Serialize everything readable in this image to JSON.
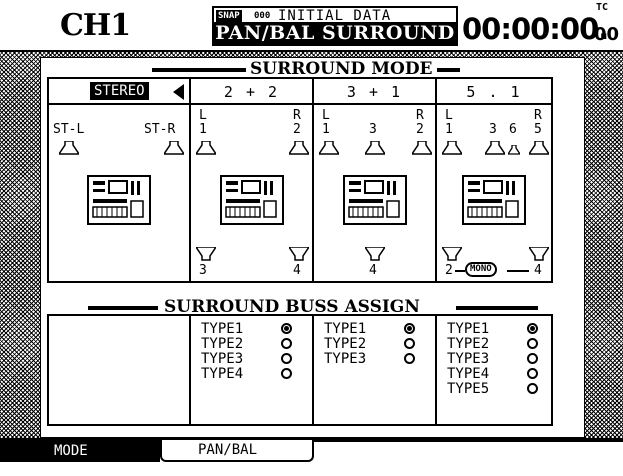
{
  "header": {
    "channel": "CH1",
    "snap_badge": "SNAP",
    "snap_number": "000",
    "snap_name": "INITIAL_DATA",
    "screen_title": "PAN/BAL SURROUND",
    "tc_label": "TC",
    "timecode": "00:00:00.",
    "timecode_frames": "00"
  },
  "surround_mode": {
    "title": "SURROUND MODE",
    "columns": [
      {
        "label": "STEREO",
        "selected": true,
        "top_channels": [
          "ST-L",
          "ST-R"
        ],
        "bottom_channels": []
      },
      {
        "label": "2 + 2",
        "top_channels": [
          "L 1",
          "R 2"
        ],
        "bottom_channels": [
          "3",
          "4"
        ]
      },
      {
        "label": "3 + 1",
        "top_channels": [
          "L 1",
          "3",
          "R 2"
        ],
        "bottom_channels": [
          "4"
        ]
      },
      {
        "label": "5 . 1",
        "top_channels": [
          "L 1",
          "3",
          "6",
          "R 5"
        ],
        "bottom_channels": [
          "2",
          "4"
        ],
        "mono_badge": "MONO"
      }
    ],
    "top_letters": {
      "L": "L",
      "R": "R"
    },
    "numbers": {
      "c2_l": "1",
      "c2_r": "2",
      "c2_b1": "3",
      "c2_b2": "4",
      "c3_l": "1",
      "c3_c": "3",
      "c3_r": "2",
      "c3_b": "4",
      "c4_l": "1",
      "c4_c": "3",
      "c4_lfe": "6",
      "c4_r": "5",
      "c4_b1": "2",
      "c4_b2": "4"
    }
  },
  "buss_assign": {
    "title": "SURROUND BUSS ASSIGN",
    "col2": [
      "TYPE1",
      "TYPE2",
      "TYPE3",
      "TYPE4"
    ],
    "col3": [
      "TYPE1",
      "TYPE2",
      "TYPE3"
    ],
    "col4": [
      "TYPE1",
      "TYPE2",
      "TYPE3",
      "TYPE4",
      "TYPE5"
    ],
    "selected_index": 0
  },
  "tabs": {
    "mode": "MODE",
    "panbal": "PAN/BAL"
  }
}
